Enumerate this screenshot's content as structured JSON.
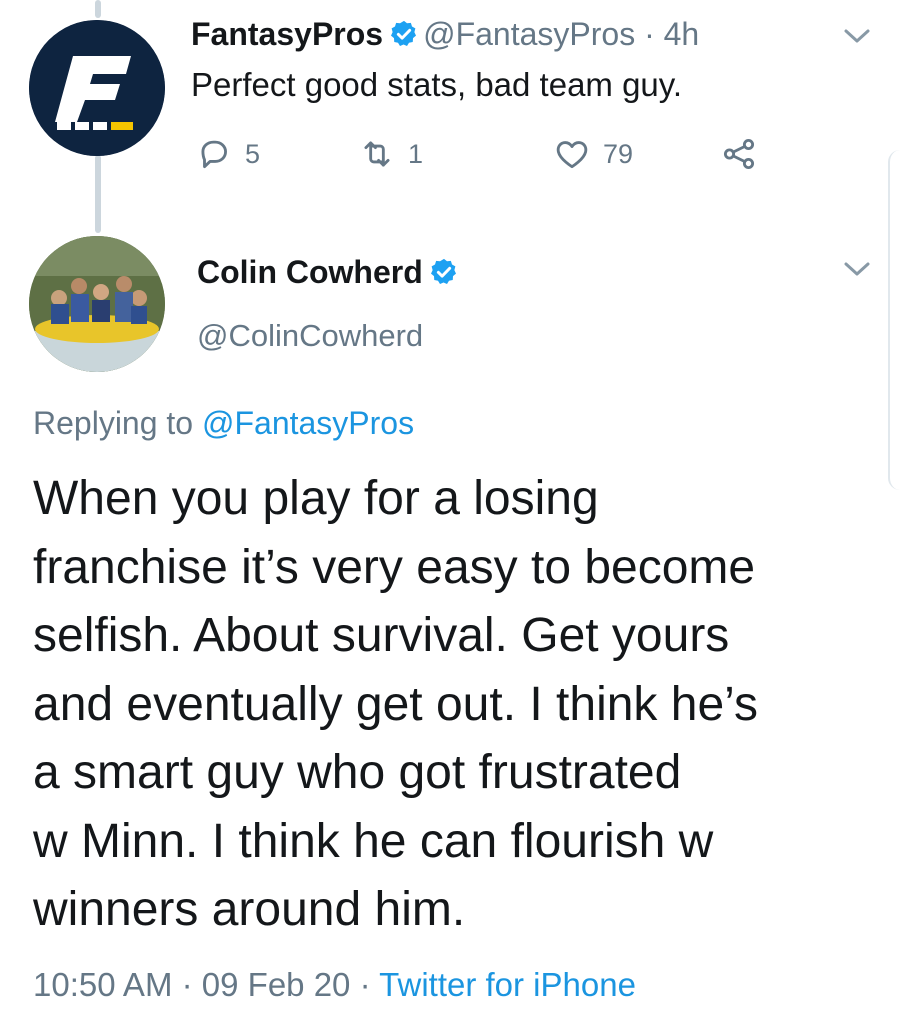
{
  "colors": {
    "text": "#14171a",
    "secondary": "#657786",
    "link": "#1b95e0",
    "verified": "#1da1f2",
    "thread_line": "#ccd6dd"
  },
  "tweet1": {
    "author_name": "FantasyPros",
    "handle": "@FantasyPros",
    "separator": "·",
    "age": "4h",
    "text": "Perfect good stats, bad team guy.",
    "reply_count": "5",
    "retweet_count": "1",
    "like_count": "79",
    "icons": [
      "reply-icon",
      "retweet-icon",
      "like-icon",
      "share-icon",
      "chevron-down-icon",
      "verified-badge-icon"
    ]
  },
  "tweet2": {
    "author_name": "Colin Cowherd",
    "handle": "@ColinCowherd",
    "replying_prefix": "Replying to",
    "replying_handle": "@FantasyPros",
    "text": "When you play for a losing\nfranchise it’s very easy to become\nselfish.  About survival.  Get yours\nand eventually get out.  I think he’s\na smart guy who got frustrated\nw Minn.  I think he can flourish w\nwinners around him.",
    "time": "10:50 AM",
    "date": "09 Feb 20",
    "separator": "·",
    "source": "Twitter for iPhone"
  }
}
